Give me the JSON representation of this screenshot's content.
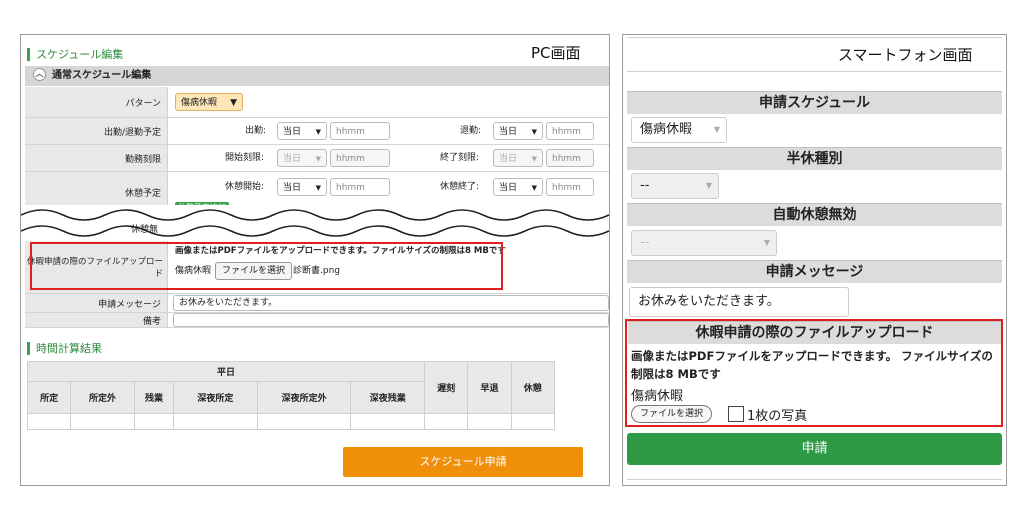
{
  "pc": {
    "section_title": "スケジュール編集",
    "caption": "PC画面",
    "subheader": "通常スケジュール編集",
    "collapse_icon": "chevron-up-icon",
    "pattern_label": "パターン",
    "pattern_value": "傷病休暇",
    "attend_label": "出勤/退勤予定",
    "shukkin_label": "出勤:",
    "taikin_label": "退勤:",
    "day_value": "当日",
    "time_placeholder": "hhmm",
    "worktime_label": "勤務刻限",
    "start_limit_label": "開始刻限:",
    "end_limit_label": "終了刻限:",
    "break_label": "休憩予定",
    "break_start_label": "休憩開始:",
    "break_end_label": "休憩終了:",
    "add_break": "休憩予定追加",
    "hidden_label_fragment": "休憩無",
    "upload_label": "休暇申請の際のファイルアップロード",
    "upload_note": "画像またはPDFファイルをアップロードできます。ファイルサイズの制限は8 MBです",
    "upload_kind": "傷病休暇",
    "file_button": "ファイルを選択",
    "file_name": "診断書.png",
    "message_label": "申請メッセージ",
    "message_value": "お休みをいただきます。",
    "remarks_label": "備考",
    "calc_title": "時間計算結果",
    "table": {
      "group_header": "平日",
      "columns": [
        "所定",
        "所定外",
        "残業",
        "深夜所定",
        "深夜所定外",
        "深夜残業"
      ],
      "extra_columns": [
        "遅刻",
        "早退",
        "休憩"
      ]
    },
    "submit_button": "スケジュール申請"
  },
  "sp": {
    "caption": "スマートフォン画面",
    "schedule_header": "申請スケジュール",
    "schedule_value": "傷病休暇",
    "halfday_header": "半休種別",
    "halfday_value": "--",
    "autobreak_header": "自動休憩無効",
    "autobreak_value": "--",
    "message_header": "申請メッセージ",
    "message_value": "お休みをいただきます。",
    "upload_header": "休暇申請の際のファイルアップロード",
    "upload_note": "画像またはPDFファイルをアップロードできます。 ファイルサイズの制限は8 MBです",
    "upload_kind": "傷病休暇",
    "file_button": "ファイルを選択",
    "photo_label": "1枚の写真",
    "submit_button": "申請"
  },
  "colors": {
    "highlight_red": "#e02020",
    "submit_orange": "#f0900a",
    "submit_green": "#2e9a46",
    "section_green": "#3aa24a"
  }
}
